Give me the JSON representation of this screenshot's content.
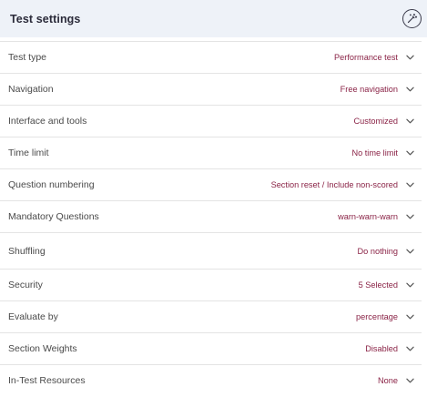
{
  "header": {
    "title": "Test settings",
    "action_icon": "magic-wand-icon"
  },
  "rows": [
    {
      "label": "Test type",
      "value": "Performance test"
    },
    {
      "label": "Navigation",
      "value": "Free navigation"
    },
    {
      "label": "Interface and tools",
      "value": "Customized"
    },
    {
      "label": "Time limit",
      "value": "No time limit"
    },
    {
      "label": "Question numbering",
      "value": "Section reset / Include non-scored"
    },
    {
      "label": "Mandatory Questions",
      "value": "warn-warn-warn"
    },
    {
      "label": "Shuffling",
      "value": "Do nothing"
    },
    {
      "label": "Security",
      "value": "5 Selected"
    },
    {
      "label": "Evaluate by",
      "value": "percentage"
    },
    {
      "label": "Section Weights",
      "value": "Disabled"
    },
    {
      "label": "In-Test Resources",
      "value": "None"
    }
  ],
  "colors": {
    "header_bg": "#eef2f8",
    "value_text": "#8a2346",
    "divider": "#e4e4e4"
  }
}
